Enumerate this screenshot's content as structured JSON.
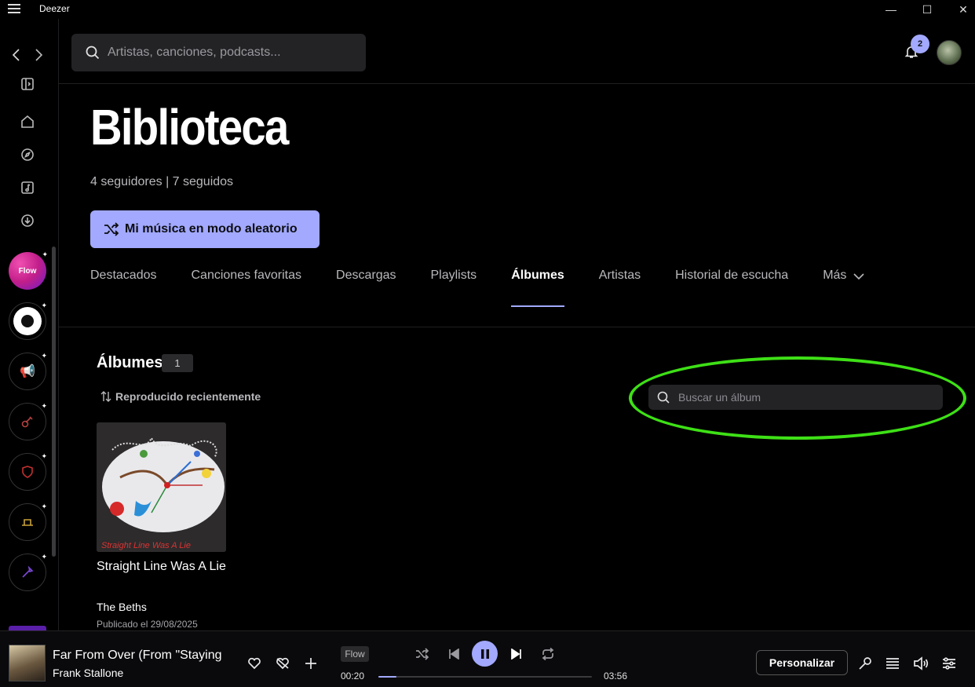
{
  "window": {
    "title": "Deezer",
    "minimize": "—",
    "maximize": "☐",
    "close": "✕"
  },
  "search": {
    "placeholder": "Artistas, canciones, podcasts..."
  },
  "notifications": {
    "count": "2"
  },
  "page": {
    "title": "Biblioteca",
    "followers": "4 seguidores | 7 seguidos",
    "shuffle_label": "Mi música en modo aleatorio"
  },
  "tabs": [
    {
      "label": "Destacados"
    },
    {
      "label": "Canciones favoritas"
    },
    {
      "label": "Descargas"
    },
    {
      "label": "Playlists"
    },
    {
      "label": "Álbumes",
      "active": true
    },
    {
      "label": "Artistas"
    },
    {
      "label": "Historial de escucha"
    },
    {
      "label": "Más"
    }
  ],
  "albums_section": {
    "title": "Álbumes",
    "count": "1",
    "sort_label": "Reproducido recientemente",
    "search_placeholder": "Buscar un álbum"
  },
  "albums": [
    {
      "title": "Straight Line Was A Lie",
      "artist": "The Beths",
      "date": "Publicado el 29/08/2025",
      "cover_text": "Straight Line Was A Lie"
    }
  ],
  "sidebar": {
    "flow_label": "Flow"
  },
  "player": {
    "track": "Far From Over (From \"Staying",
    "artist": "Frank Stallone",
    "source_tag": "Flow",
    "elapsed": "00:20",
    "duration": "03:56",
    "progress_fraction": 0.085,
    "personalize_label": "Personalizar"
  },
  "colors": {
    "accent": "#a2a9ff",
    "highlight": "#3ee016"
  }
}
